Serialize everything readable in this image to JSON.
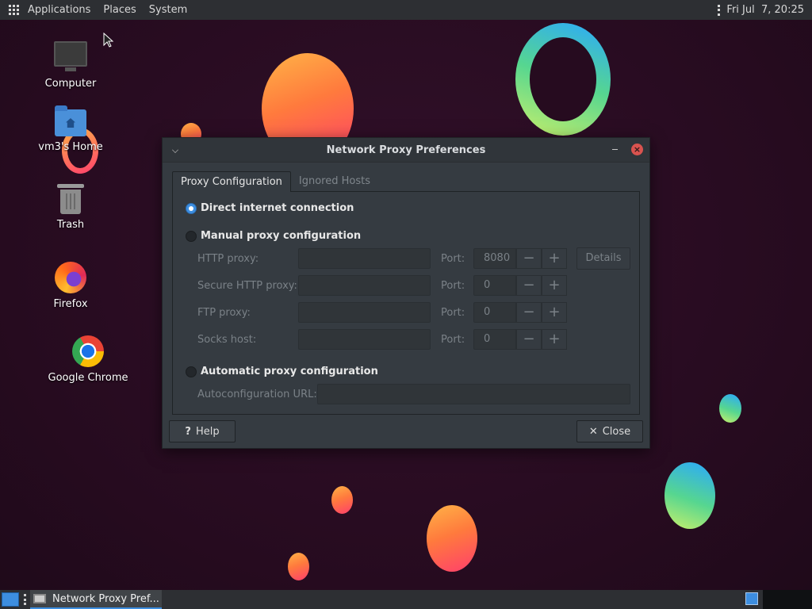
{
  "top_panel": {
    "menus": [
      "Applications",
      "Places",
      "System"
    ],
    "clock": "Fri Jul  7, 20:25"
  },
  "desktop": {
    "icons": [
      {
        "label": "Computer",
        "icon": "computer-icon"
      },
      {
        "label": "vm3's Home",
        "icon": "home-folder-icon"
      },
      {
        "label": "Trash",
        "icon": "trash-icon"
      },
      {
        "label": "Firefox",
        "icon": "firefox-icon"
      },
      {
        "label": "Google Chrome",
        "icon": "chrome-icon"
      }
    ]
  },
  "dialog": {
    "title": "Network Proxy Preferences",
    "tabs": [
      "Proxy Configuration",
      "Ignored Hosts"
    ],
    "active_tab": "Proxy Configuration",
    "direct_label": "Direct internet connection",
    "manual_label": "Manual proxy configuration",
    "auto_label": "Automatic proxy configuration",
    "selected_mode": "direct",
    "port_label": "Port:",
    "rows": [
      {
        "label": "HTTP proxy:",
        "host": "",
        "port": "8080"
      },
      {
        "label": "Secure HTTP proxy:",
        "host": "",
        "port": "0"
      },
      {
        "label": "FTP proxy:",
        "host": "",
        "port": "0"
      },
      {
        "label": "Socks host:",
        "host": "",
        "port": "0"
      }
    ],
    "details_label": "Details",
    "autoconfig_label": "Autoconfiguration URL:",
    "autoconfig_value": "",
    "help_label": "Help",
    "close_label": "Close"
  },
  "taskbar": {
    "task_label": "Network Proxy Pref..."
  },
  "colors": {
    "accent": "#3d8ee0",
    "close_button": "#d9534f",
    "dialog_bg": "#353b41"
  }
}
